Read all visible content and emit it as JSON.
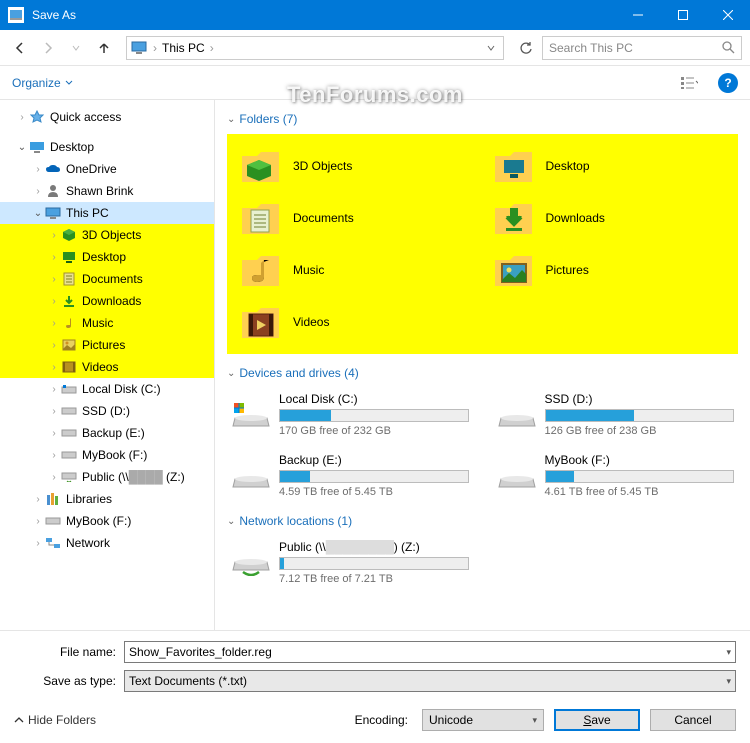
{
  "window": {
    "title": "Save As"
  },
  "nav": {
    "crumb_root": "This PC",
    "search_placeholder": "Search This PC"
  },
  "toolbar": {
    "organize": "Organize"
  },
  "tree": {
    "quick_access": "Quick access",
    "desktop": "Desktop",
    "onedrive": "OneDrive",
    "user": "Shawn Brink",
    "this_pc": "This PC",
    "pc_children": {
      "objects3d": "3D Objects",
      "desktop": "Desktop",
      "documents": "Documents",
      "downloads": "Downloads",
      "music": "Music",
      "pictures": "Pictures",
      "videos": "Videos",
      "localdisk": "Local Disk (C:)",
      "ssd": "SSD (D:)",
      "backup": "Backup (E:)",
      "mybook": "MyBook (F:)",
      "public": "Public (\\\\",
      "public_suffix": "(Z:)"
    },
    "libraries": "Libraries",
    "mybook2": "MyBook (F:)",
    "network": "Network"
  },
  "sections": {
    "folders": "Folders (7)",
    "drives": "Devices and drives (4)",
    "network": "Network locations (1)"
  },
  "folders": {
    "objects3d": "3D Objects",
    "desktop": "Desktop",
    "documents": "Documents",
    "downloads": "Downloads",
    "music": "Music",
    "pictures": "Pictures",
    "videos": "Videos"
  },
  "drives": {
    "c": {
      "name": "Local Disk (C:)",
      "free": "170 GB free of 232 GB",
      "pct": 27
    },
    "d": {
      "name": "SSD (D:)",
      "free": "126 GB free of 238 GB",
      "pct": 47
    },
    "e": {
      "name": "Backup (E:)",
      "free": "4.59 TB free of 5.45 TB",
      "pct": 16
    },
    "f": {
      "name": "MyBook (F:)",
      "free": "4.61 TB free of 5.45 TB",
      "pct": 15
    }
  },
  "netloc": {
    "z": {
      "name_prefix": "Public (\\\\",
      "name_suffix": "(Z:)",
      "free": "7.12 TB free of 7.21 TB",
      "pct": 2
    }
  },
  "fields": {
    "filename_label": "File name:",
    "filename_value": "Show_Favorites_folder.reg",
    "savetype_label": "Save as type:",
    "savetype_value": "Text Documents (*.txt)"
  },
  "footer": {
    "hide_folders": "Hide Folders",
    "encoding_label": "Encoding:",
    "encoding_value": "Unicode",
    "save": "Save",
    "save_ul": "S",
    "save_rest": "ave",
    "cancel": "Cancel"
  },
  "watermark": "TenForums.com"
}
